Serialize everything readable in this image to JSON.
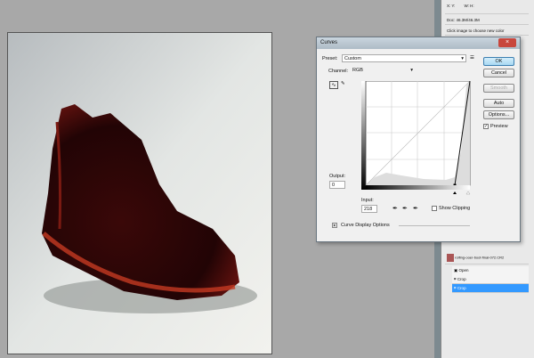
{
  "right_panel": {
    "info_xy": "X: Y:",
    "info_wh": "W: H:",
    "doc": "Doc: 46.3M/46.3M",
    "hint": "Click image to choose new color"
  },
  "history": {
    "snapshot": "rolfing-ooer-boot-final-072.CR2",
    "items": [
      {
        "label": "Open",
        "selected": false
      },
      {
        "label": "Crop",
        "selected": false
      },
      {
        "label": "Crop",
        "selected": true
      }
    ]
  },
  "curves": {
    "title": "Curves",
    "preset_label": "Preset:",
    "preset_value": "Custom",
    "channel_label": "Channel:",
    "channel_value": "RGB",
    "buttons": {
      "ok": "OK",
      "cancel": "Cancel",
      "smooth": "Smooth",
      "auto": "Auto",
      "options": "Options..."
    },
    "preview_label": "Preview",
    "preview_checked": true,
    "output_label": "Output:",
    "output_value": "0",
    "input_label": "Input:",
    "input_value": "218",
    "show_clipping_label": "Show Clipping",
    "show_clipping_checked": false,
    "display_options_label": "Curve Display Options",
    "curve_points": [
      [
        218,
        0
      ],
      [
        255,
        255
      ]
    ]
  },
  "colors": {
    "accent": "#3399ff",
    "close": "#c8463c"
  }
}
